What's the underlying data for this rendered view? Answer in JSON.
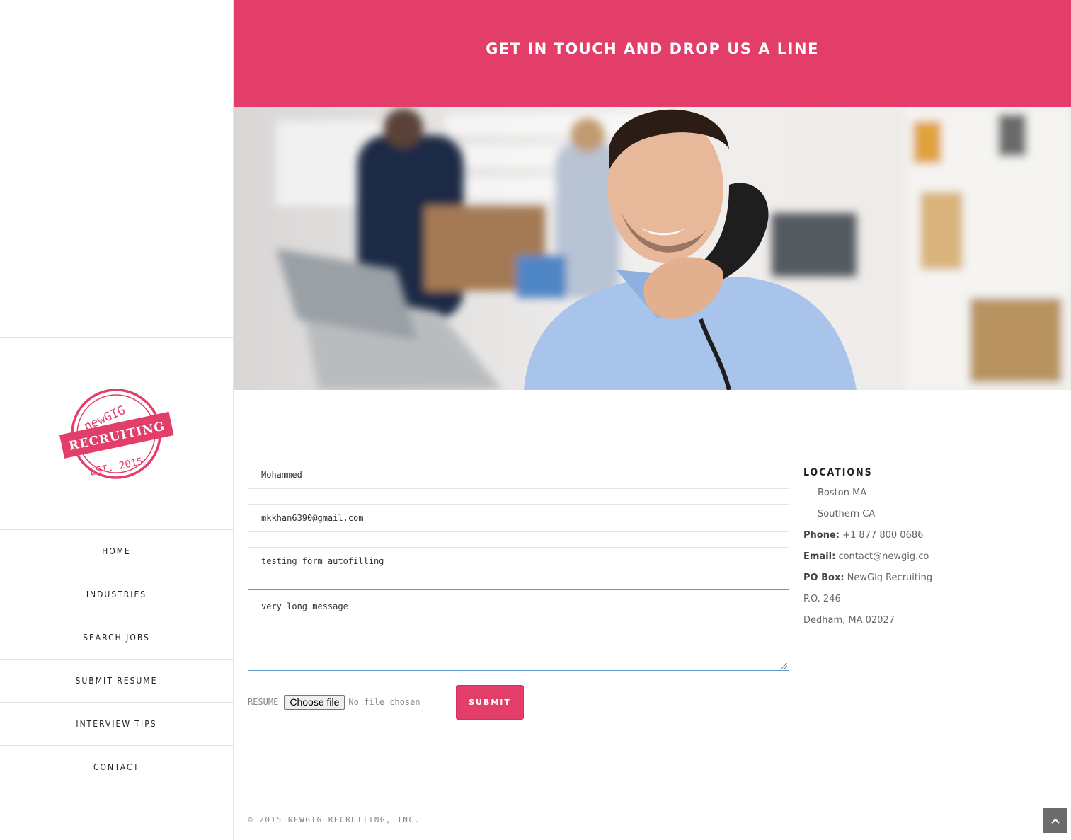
{
  "hero": {
    "title": "GET IN TOUCH AND DROP US A LINE"
  },
  "logo": {
    "line1": "newGIG",
    "line2": "RECRUITING",
    "line3": "EST. 2015"
  },
  "nav": {
    "items": [
      {
        "label": "HOME"
      },
      {
        "label": "INDUSTRIES"
      },
      {
        "label": "SEARCH JOBS"
      },
      {
        "label": "SUBMIT RESUME"
      },
      {
        "label": "INTERVIEW TIPS"
      },
      {
        "label": "CONTACT"
      }
    ]
  },
  "form": {
    "name_value": "Mohammed",
    "email_value": "mkkhan6390@gmail.com",
    "subject_value": "testing form autofilling",
    "message_value": "very long message",
    "resume_label": "RESUME",
    "choose_file_label": "Choose file",
    "no_file_text": "No file chosen",
    "submit_label": "SUBMIT"
  },
  "locations": {
    "heading": "LOCATIONS",
    "places": [
      "Boston MA",
      "Southern CA"
    ],
    "phone_label": "Phone:",
    "phone_value": "+1 877 800 0686",
    "email_label": "Email:",
    "email_value": "contact@newgig.co",
    "pobox_label": "PO Box:",
    "pobox_value": "NewGig Recruiting",
    "address_line1": "P.O. 246",
    "address_line2": "Dedham, MA 02027"
  },
  "footer": {
    "copyright": "© 2015 NEWGIG RECRUITING, INC."
  },
  "colors": {
    "accent": "#e33d6a",
    "text": "#555555",
    "border": "#e4e4e4"
  },
  "icons": {
    "scroll_top": "chevron-up-icon"
  }
}
